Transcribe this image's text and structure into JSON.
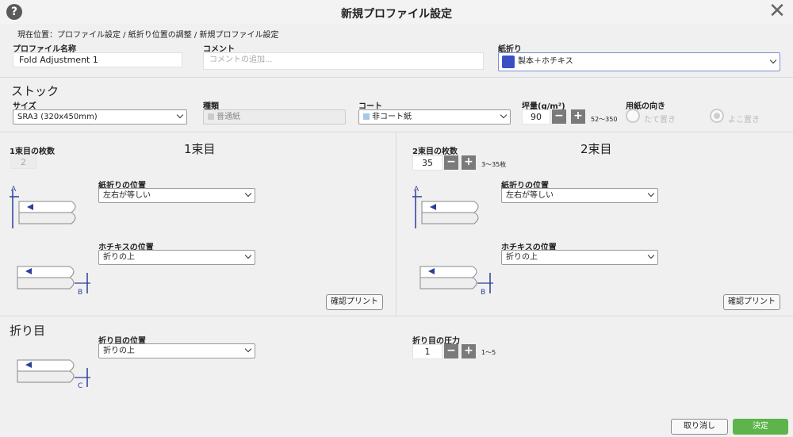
{
  "window": {
    "title": "新規プロファイル設定"
  },
  "breadcrumb": "現在位置：プロファイル設定 / 紙折り位置の調整 / 新規プロファイル設定",
  "profile": {
    "name_label": "プロファイル名称",
    "name_value": "Fold Adjustment 1",
    "comment_label": "コメント",
    "comment_placeholder": "コメントの追加...",
    "fold_label": "紙折り",
    "fold_value": "製本＋ホチキス"
  },
  "stock": {
    "title": "ストック",
    "size_label": "サイズ",
    "size_value": "SRA3 (320x450mm)",
    "type_label": "種類",
    "type_value": "普通紙",
    "coat_label": "コート",
    "coat_value": "非コート紙",
    "weight_label": "坪量(g/m²)",
    "weight_value": "90",
    "weight_range": "52～350",
    "orientation_label": "用紙の向き",
    "orientation_options": [
      "たて置き",
      "よこ置き"
    ]
  },
  "bundle1": {
    "count_label": "1束目の枚数",
    "count_value": "2",
    "heading": "1束目",
    "fold_pos_label": "紙折りの位置",
    "fold_pos_value": "左右が等しい",
    "staple_label": "ホチキスの位置",
    "staple_value": "折りの上",
    "marker_a": "A",
    "marker_b": "B",
    "print_button": "確認プリント"
  },
  "bundle2": {
    "count_label": "2束目の枚数",
    "count_value": "35",
    "count_range": "3～35枚",
    "heading": "2束目",
    "fold_pos_label": "紙折りの位置",
    "fold_pos_value": "左右が等しい",
    "staple_label": "ホチキスの位置",
    "staple_value": "折りの上",
    "marker_a": "A",
    "marker_b": "B",
    "print_button": "確認プリント"
  },
  "crease": {
    "title": "折り目",
    "pos_label": "折り目の位置",
    "pos_value": "折りの上",
    "pressure_label": "折り目の圧力",
    "pressure_value": "1",
    "pressure_range": "1～5",
    "marker_c": "C"
  },
  "footer": {
    "cancel": "取り消し",
    "ok": "決定"
  },
  "step": {
    "minus": "−",
    "plus": "+"
  },
  "colors": {
    "accent": "#5db44a",
    "fold_icon": "#3b4fc4",
    "coat_swatch": "#a6c8e6",
    "type_swatch": "#cccccc"
  }
}
